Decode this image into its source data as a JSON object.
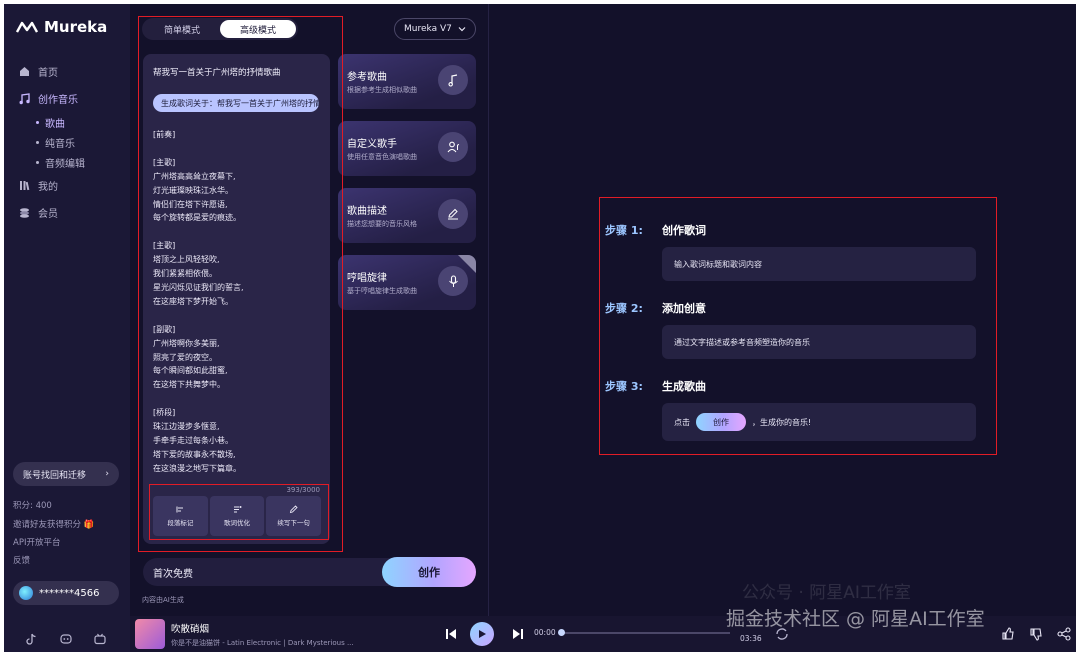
{
  "app": {
    "logo_text": "Mureka"
  },
  "sidebar": {
    "items": [
      {
        "label": "首页",
        "icon": "home-icon"
      },
      {
        "label": "创作音乐",
        "icon": "music-note-icon"
      }
    ],
    "sub_items": [
      "歌曲",
      "纯音乐",
      "音频编辑"
    ],
    "items_after": [
      {
        "label": "我的",
        "icon": "library-icon"
      },
      {
        "label": "会员",
        "icon": "member-icon"
      }
    ],
    "recover_label": "账号找回和迁移",
    "points": "积分: 400",
    "invite": "邀请好友获得积分",
    "api": "API开放平台",
    "feedback": "反馈",
    "user_name": "*******4566"
  },
  "mode_tabs": [
    "简单模式",
    "高级模式"
  ],
  "model": "Mureka V7",
  "lyrics_card": {
    "prompt": "帮我写一首关于广州塔的抒情歌曲",
    "chip": "生成歌词关于：帮我写一首关于广州塔的抒情歌曲",
    "lyrics": "[前奏]\n\n[主歌]\n广州塔高高耸立夜幕下,\n灯光璀璨映珠江水华。\n情侣们在塔下许愿语,\n每个旋转都是爱的痕迹。\n\n[主歌]\n塔顶之上风轻轻吹,\n我们紧紧相依偎。\n星光闪烁见证我们的誓言,\n在这座塔下梦开始飞。\n\n[副歌]\n广州塔啊你多美丽,\n照亮了爱的夜空。\n每个瞬间都如此甜蜜,\n在这塔下共舞梦中。\n\n[桥段]\n珠江边漫步多惬意,\n手牵手走过每条小巷。\n塔下爱的故事永不散场,\n在这浪漫之地写下篇章。",
    "counter": "393/3000",
    "tools": [
      {
        "label": "段落标记",
        "icon": "paragraph-mark-icon"
      },
      {
        "label": "歌词优化",
        "icon": "lyrics-optimize-icon"
      },
      {
        "label": "续写下一句",
        "icon": "pencil-icon"
      }
    ]
  },
  "features": [
    {
      "title": "参考歌曲",
      "sub": "根据参考生成相似歌曲",
      "icon": "music-note-icon"
    },
    {
      "title": "自定义歌手",
      "sub": "使用任意音色演唱歌曲",
      "icon": "singer-icon"
    },
    {
      "title": "歌曲描述",
      "sub": "描述您想要的音乐风格",
      "icon": "edit-icon"
    },
    {
      "title": "哼唱旋律",
      "sub": "基于哼唱旋律生成歌曲",
      "icon": "microphone-icon"
    }
  ],
  "footer_bar": {
    "free_label": "首次免费",
    "create_label": "创作",
    "ai_note": "内容由AI生成"
  },
  "steps": [
    {
      "label": "步骤 1:",
      "title": "创作歌词",
      "desc": "输入歌词标题和歌词内容"
    },
    {
      "label": "步骤 2:",
      "title": "添加创意",
      "desc": "通过文字描述或参考音频塑造你的音乐"
    },
    {
      "label": "步骤 3:",
      "title": "生成歌曲",
      "desc_before": "点击",
      "button": "创作",
      "desc_after": "，生成你的音乐!"
    }
  ],
  "player": {
    "title": "吹散硝烟",
    "subtitle": "你是不是油猫饼 - Latin Electronic | Dark Mysterious ...",
    "current_time": "00:00",
    "total_time": "03:36"
  },
  "watermark": "掘金技术社区 @ 阿星AI工作室",
  "watermark_bg": "公众号 · 阿星AI工作室",
  "colors": {
    "accent": "#c8b8ff",
    "highlight": "#e11c26",
    "step_label": "#9cc6ff"
  }
}
